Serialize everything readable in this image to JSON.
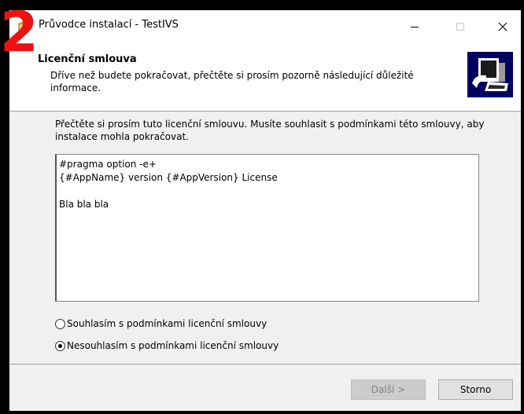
{
  "overlay_badge": "2",
  "window": {
    "title": "Průvodce instalací - TestIVS",
    "controls": {
      "minimize_icon": "minimize-icon",
      "maximize_icon": "maximize-icon",
      "close_icon": "close-icon"
    }
  },
  "header": {
    "title": "Licenční smlouva",
    "subtitle": "Dříve než budete pokračovat, přečtěte si prosím pozorně následující důležité informace."
  },
  "intro": "Přečtěte si prosím tuto licenční smlouvu. Musíte souhlasit s podmínkami této smlouvy, aby instalace mohla pokračovat.",
  "license_lines": [
    "#pragma option -e+",
    "{#AppName} version {#AppVersion} License",
    "",
    "Bla bla bla"
  ],
  "options": {
    "accept_label": "Souhlasím s podmínkami licenční smlouvy",
    "decline_label": "Nesouhlasím s podmínkami licenční smlouvy",
    "selected": "decline"
  },
  "buttons": {
    "next_label": "Další >",
    "cancel_label": "Storno"
  },
  "colors": {
    "accent_badge": "#ee1111",
    "window_bg": "#f0f0f0",
    "header_bg": "#ffffff"
  }
}
